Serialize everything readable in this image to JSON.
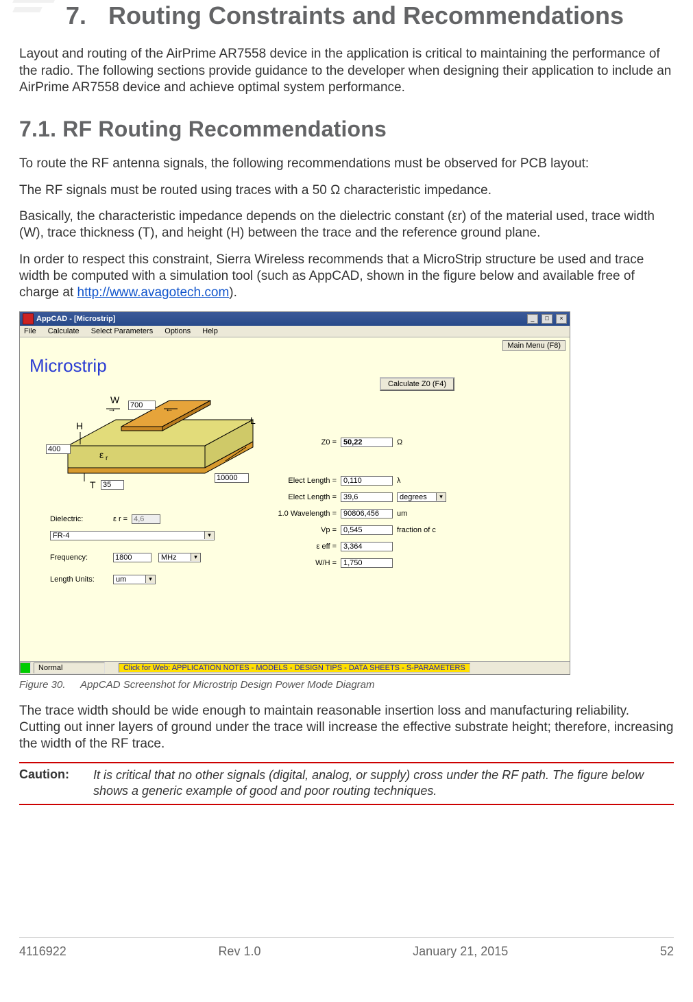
{
  "section": {
    "number": "7.",
    "title": "Routing Constraints and Recommendations",
    "intro": "Layout and routing of the AirPrime AR7558 device in the application is critical to maintaining the performance of the radio. The following sections provide guidance to the developer when designing their application to include an AirPrime AR7558 device and achieve optimal system performance."
  },
  "subsection": {
    "number_title": "7.1.    RF Routing Recommendations",
    "p1": "To route the RF antenna signals, the following recommendations must be observed for PCB layout:",
    "p2": "The RF signals must be routed using traces with a 50 Ω characteristic impedance.",
    "p3": "Basically, the characteristic impedance depends on the dielectric constant (εr) of the material used, trace width (W), trace thickness (T), and height (H) between the trace and the reference ground plane.",
    "p4_pre": "In order to respect this constraint, Sierra Wireless recommends that a MicroStrip structure be used and trace width be computed with a simulation tool (such as AppCAD, shown in the figure below and available free of charge at ",
    "p4_link": "http://www.avagotech.com",
    "p4_post": ").",
    "p5": "The trace width should be wide enough to maintain reasonable insertion loss and manufacturing reliability. Cutting out inner layers of ground under the trace will increase the effective substrate height; therefore, increasing the width of the RF trace."
  },
  "figure": {
    "number": "Figure 30.",
    "caption": "AppCAD Screenshot for Microstrip Design Power Mode Diagram"
  },
  "caution": {
    "label": "Caution:",
    "text": "It is critical that no other signals (digital, analog, or supply) cross under the RF path. The figure below shows a generic example of good and poor routing techniques."
  },
  "footer": {
    "docnum": "4116922",
    "rev": "Rev 1.0",
    "date": "January 21, 2015",
    "page": "52"
  },
  "appcad": {
    "title": "AppCAD - [Microstrip]",
    "menus": [
      "File",
      "Calculate",
      "Select Parameters",
      "Options",
      "Help"
    ],
    "mainmenu_btn": "Main Menu (F8)",
    "heading": "Microstrip",
    "labels": {
      "W": "W",
      "H": "H",
      "T": "T",
      "L": "L",
      "er": "εr"
    },
    "inputs": {
      "W": "700",
      "H": "400",
      "T": "35",
      "L": "10000",
      "er": "4,6",
      "material": "FR-4",
      "freq": "1800",
      "freq_unit": "MHz",
      "length_units": "um"
    },
    "left_labels": {
      "dielectric": "Dielectric:",
      "er_sym": "ε r =",
      "frequency": "Frequency:",
      "length_units": "Length Units:"
    },
    "calc_btn": "Calculate Z0  (F4)",
    "outputs": {
      "Z0_lbl": "Z0 =",
      "Z0": "50,22",
      "Z0_unit": "Ω",
      "el1_lbl": "Elect Length =",
      "el1": "0,110",
      "el1_unit": "λ",
      "el2_lbl": "Elect Length =",
      "el2": "39,6",
      "el2_unit": "degrees",
      "wl_lbl": "1.0 Wavelength =",
      "wl": "90806,456",
      "wl_unit": "um",
      "vp_lbl": "Vp =",
      "vp": "0,545",
      "vp_unit": "fraction of c",
      "eeff_lbl": "ε eff =",
      "eeff": "3,364",
      "wh_lbl": "W/H =",
      "wh": "1,750"
    },
    "status": {
      "mode": "Normal",
      "banner": "Click for Web: APPLICATION NOTES - MODELS - DESIGN TIPS - DATA SHEETS - S-PARAMETERS"
    }
  }
}
